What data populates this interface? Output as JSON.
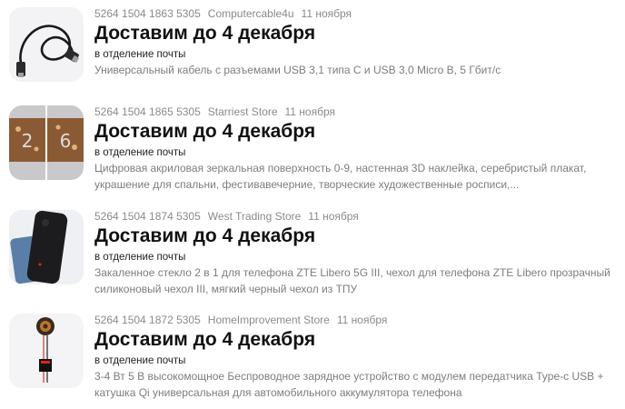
{
  "orders": [
    {
      "number": "5264 1504 1863 5305",
      "store": "Computercable4u",
      "date": "11 ноября",
      "headline": "Доставим до 4 декабря",
      "delivery": "в отделение почты",
      "description": "Универсальный кабель с разъемами USB 3,1 типа C и USB 3,0 Micro B, 5 Гбит/с",
      "thumbnail_icon": "usb-cable-icon"
    },
    {
      "number": "5264 1504 1865 5305",
      "store": "Starriest Store",
      "date": "11 ноября",
      "headline": "Доставим до 4 декабря",
      "delivery": "в отделение почты",
      "description": "Цифровая акриловая зеркальная поверхность 0-9, настенная 3D наклейка, серебристый плакат, украшение для спальни, фестивавечерние, творческие художественные росписи,...",
      "thumbnail_icon": "mirror-digit-sticker-icon"
    },
    {
      "number": "5264 1504 1874 5305",
      "store": "West Trading Store",
      "date": "11 ноября",
      "headline": "Доставим до 4 декабря",
      "delivery": "в отделение почты",
      "description": "Закаленное стекло 2 в 1 для телефона ZTE Libero 5G III, чехол для телефона ZTE Libero прозрачный силиконовый чехол III, мягкий черный чехол из ТПУ",
      "thumbnail_icon": "phone-case-icon"
    },
    {
      "number": "5264 1504 1872 5305",
      "store": "HomeImprovement Store",
      "date": "11 ноября",
      "headline": "Доставим до 4 декабря",
      "delivery": "в отделение почты",
      "description": "3-4 Вт 5 В высокомощное Беспроводное зарядное устройство с модулем передатчика Type-c USB + катушка Qi универсальная для автомобильного аккумулятора телефона",
      "thumbnail_icon": "wireless-charger-coil-icon"
    }
  ]
}
